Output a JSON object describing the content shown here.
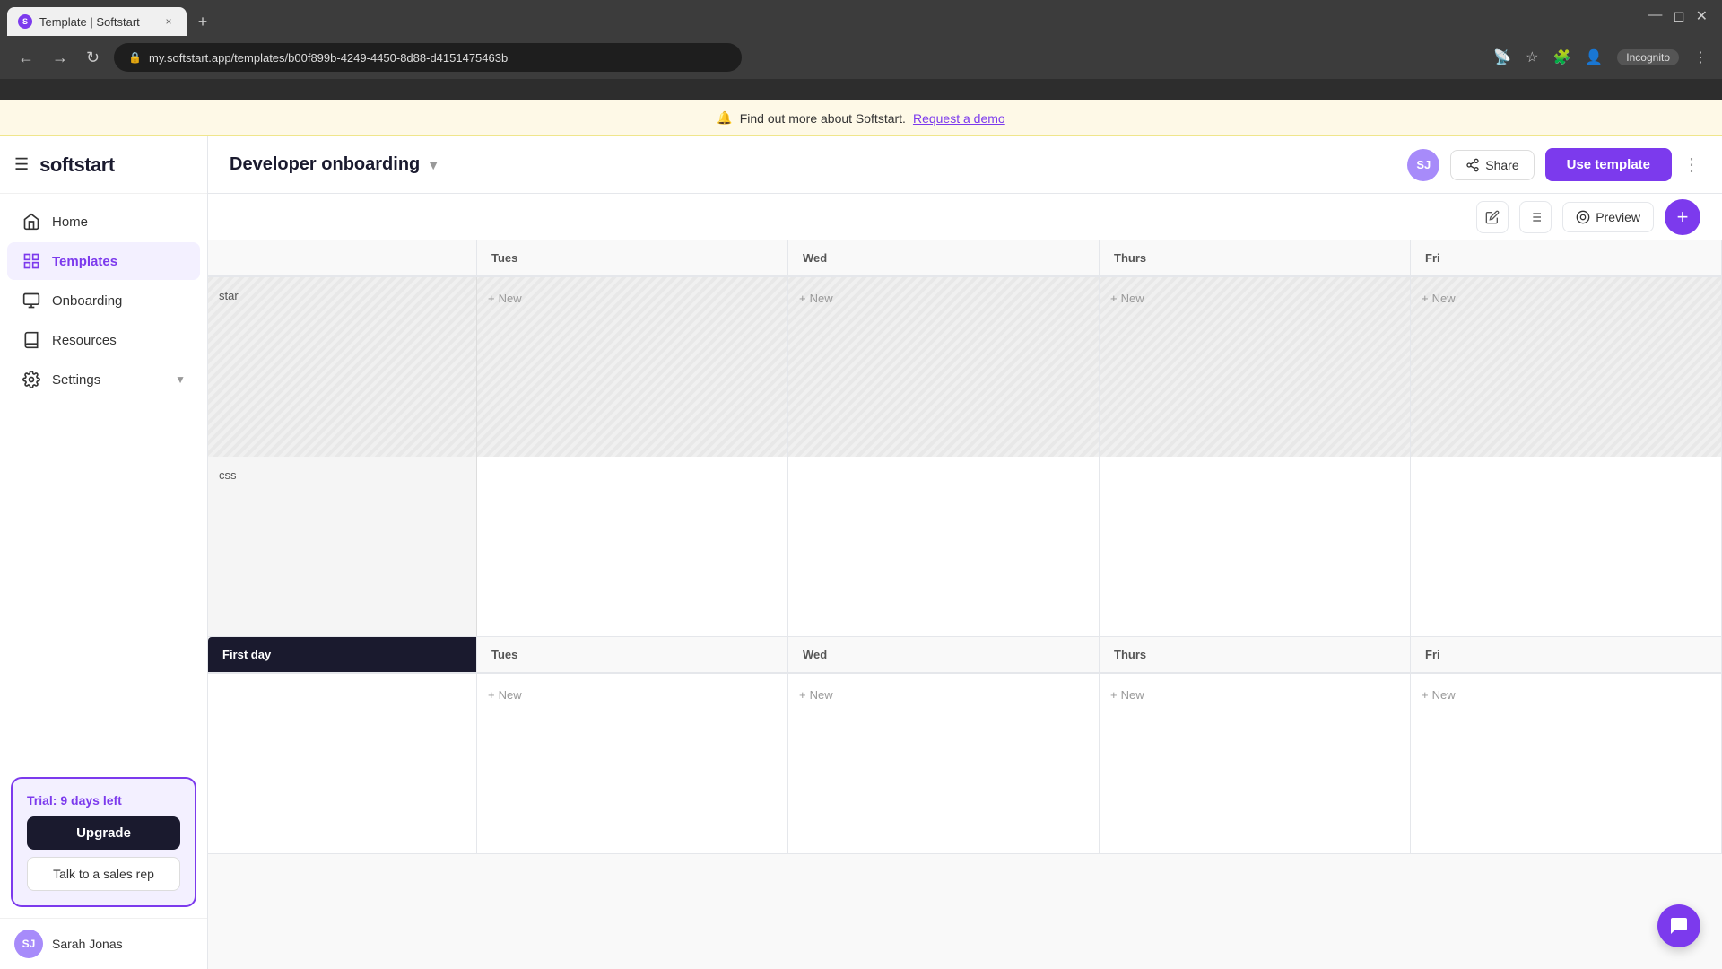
{
  "browser": {
    "tab_title": "Template | Softstart",
    "tab_close": "×",
    "tab_new": "+",
    "window_minimize": "—",
    "window_maximize": "⧉",
    "window_close": "×",
    "address": "my.softstart.app/templates/b00f899b-4249-4450-8d88-d4151475463b",
    "incognito_label": "Incognito"
  },
  "banner": {
    "emoji": "🔔",
    "text": "Find out more about Softstart.",
    "link": "Request a demo"
  },
  "sidebar": {
    "logo": "softstart",
    "nav_items": [
      {
        "id": "home",
        "label": "Home",
        "icon": "home"
      },
      {
        "id": "templates",
        "label": "Templates",
        "icon": "templates",
        "active": true
      },
      {
        "id": "onboarding",
        "label": "Onboarding",
        "icon": "onboarding"
      },
      {
        "id": "resources",
        "label": "Resources",
        "icon": "resources"
      },
      {
        "id": "settings",
        "label": "Settings",
        "icon": "settings",
        "has_chevron": true
      }
    ],
    "trial": {
      "text": "Trial: 9 days left",
      "upgrade_label": "Upgrade",
      "sales_label": "Talk to a sales rep"
    },
    "user": {
      "initials": "SJ",
      "name": "Sarah Jonas"
    }
  },
  "header": {
    "title": "Developer onboarding",
    "sj_initials": "SJ",
    "share_label": "Share",
    "use_template_label": "Use template"
  },
  "toolbar": {
    "preview_label": "Preview"
  },
  "calendar": {
    "sections": [
      {
        "id": "section1",
        "row_labels": [
          "star",
          "css"
        ],
        "columns": [
          {
            "id": "tues_header",
            "label": "Tues"
          },
          {
            "id": "wed_header",
            "label": "Wed"
          },
          {
            "id": "thurs_header",
            "label": "Thurs"
          },
          {
            "id": "fri_header",
            "label": "Fri"
          }
        ],
        "new_label": "+ New"
      },
      {
        "id": "section2",
        "columns": [
          {
            "id": "first_day_header",
            "label": "First day",
            "special": true
          },
          {
            "id": "tues_header2",
            "label": "Tues"
          },
          {
            "id": "wed_header2",
            "label": "Wed"
          },
          {
            "id": "thurs_header2",
            "label": "Thurs"
          },
          {
            "id": "fri_header2",
            "label": "Fri"
          }
        ],
        "new_label": "+ New"
      }
    ]
  },
  "chat": {
    "icon": "💬"
  }
}
